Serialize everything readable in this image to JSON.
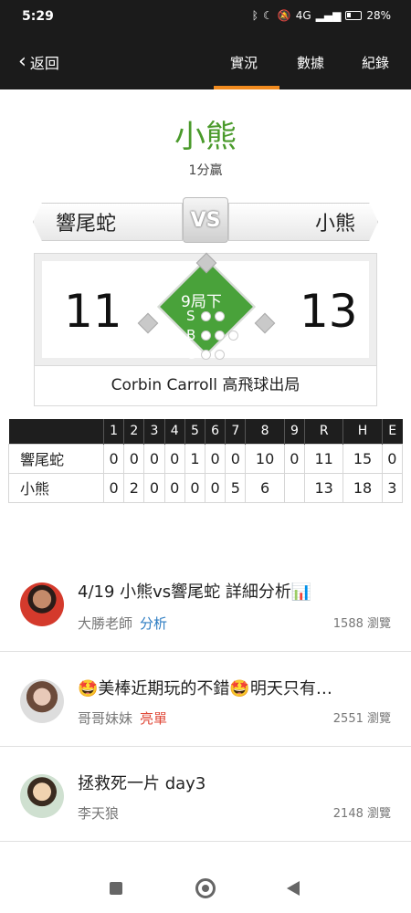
{
  "status_bar": {
    "time": "5:29",
    "icons": [
      "bluetooth-icon",
      "moon-icon",
      "mute-icon",
      "signal-icon",
      "battery-icon"
    ],
    "network": "4G",
    "battery": "28%"
  },
  "nav": {
    "back_label": "返回",
    "tabs": [
      "實況",
      "數據",
      "紀錄"
    ],
    "active_tab": "實況",
    "accent_color": "#f08a1e"
  },
  "result": {
    "winner": "小熊",
    "margin": "1分贏",
    "winner_color": "#4a9a2b"
  },
  "matchup": {
    "away": "響尾蛇",
    "vs": "VS",
    "home": "小熊"
  },
  "scoreboard": {
    "away_score": "11",
    "home_score": "13",
    "inning": "9局下",
    "count_labels": [
      "S",
      "B",
      "O"
    ],
    "strikes": 0,
    "balls": 0,
    "outs": 0,
    "last_play": "Corbin Carroll 高飛球出局"
  },
  "linescore": {
    "headers": [
      "",
      "1",
      "2",
      "3",
      "4",
      "5",
      "6",
      "7",
      "8",
      "9",
      "R",
      "H",
      "E"
    ],
    "rows": [
      [
        "響尾蛇",
        "0",
        "0",
        "0",
        "0",
        "1",
        "0",
        "0",
        "10",
        "0",
        "11",
        "15",
        "0"
      ],
      [
        "小熊",
        "0",
        "2",
        "0",
        "0",
        "0",
        "0",
        "5",
        "6",
        "",
        "13",
        "18",
        "3"
      ]
    ]
  },
  "articles": [
    {
      "title": "4/19 小熊vs響尾蛇 詳細分析📊",
      "author": "大勝老師",
      "tag": "分析",
      "views": "1588 瀏覽"
    },
    {
      "title": "🤩美棒近期玩的不錯🤩明天只有…",
      "author": "哥哥妹妹",
      "tag": "亮單",
      "views": "2551 瀏覽"
    },
    {
      "title": "拯救死一片 day3",
      "author": "李天狼",
      "tag": "",
      "views": "2148 瀏覽"
    }
  ]
}
